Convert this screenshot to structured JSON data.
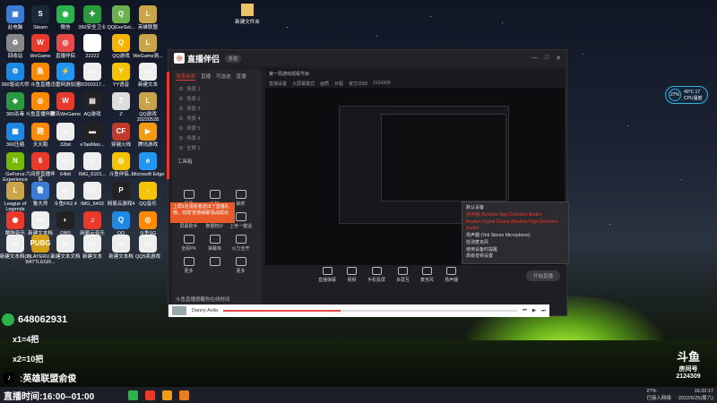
{
  "desktop": {
    "icons": [
      {
        "label": "此电脑",
        "color": "#3a7bd5",
        "glyph": "▣"
      },
      {
        "label": "Steam",
        "color": "#1b2838",
        "glyph": "S"
      },
      {
        "label": "微信",
        "color": "#2bb24c",
        "glyph": "◉"
      },
      {
        "label": "360安全卫士",
        "color": "#2b9a3e",
        "glyph": "✚"
      },
      {
        "label": "QQExeSet...",
        "color": "#6ab04c",
        "glyph": "Q"
      },
      {
        "label": "英雄联盟",
        "color": "#c9a44a",
        "glyph": "L"
      },
      {
        "label": "回收站",
        "color": "#888",
        "glyph": "♻"
      },
      {
        "label": "WeGame",
        "color": "#e8392b",
        "glyph": "W"
      },
      {
        "label": "直播伴侣",
        "color": "#e84a4a",
        "glyph": "◎"
      },
      {
        "label": "22222",
        "color": "#fff",
        "glyph": "▭"
      },
      {
        "label": "QQ游戏",
        "color": "#f4b400",
        "glyph": "Q"
      },
      {
        "label": "WeGame测...",
        "color": "#c9a44a",
        "glyph": "L"
      },
      {
        "label": "360驱动大师",
        "color": "#1e88e5",
        "glyph": "⚙"
      },
      {
        "label": "斗鱼直播",
        "color": "#ff8a00",
        "glyph": "鱼"
      },
      {
        "label": "迅雷网游加速",
        "color": "#2196f3",
        "glyph": "⚡"
      },
      {
        "label": "20200317...",
        "color": "#eee",
        "glyph": "▭"
      },
      {
        "label": "YY语音",
        "color": "#f5c400",
        "glyph": "Y"
      },
      {
        "label": "新建文本",
        "color": "#eee",
        "glyph": "▭"
      },
      {
        "label": "360杀毒",
        "color": "#2b9a3e",
        "glyph": "◈"
      },
      {
        "label": "斗鱼直播伴侣",
        "color": "#ff8a00",
        "glyph": "◎"
      },
      {
        "label": "腾讯WeGame",
        "color": "#e8392b",
        "glyph": "W"
      },
      {
        "label": "AQ游戏",
        "color": "#222",
        "glyph": "▤"
      },
      {
        "label": "Z",
        "color": "#ddd",
        "glyph": "Z"
      },
      {
        "label": "QQ游戏20220528",
        "color": "#c9a44a",
        "glyph": "L"
      },
      {
        "label": "360压缩",
        "color": "#1e88e5",
        "glyph": "▦"
      },
      {
        "label": "天天跑",
        "color": "#ff8a00",
        "glyph": "跑"
      },
      {
        "label": "32bit",
        "color": "#eee",
        "glyph": "▭"
      },
      {
        "label": "eTaaMan...",
        "color": "#222",
        "glyph": "▬"
      },
      {
        "label": "穿越火线",
        "color": "#c0392b",
        "glyph": "CF"
      },
      {
        "label": "腾讯游戏",
        "color": "#f39c12",
        "glyph": "▶"
      },
      {
        "label": "GeForce Experience",
        "color": "#76b900",
        "glyph": "N"
      },
      {
        "label": "六间房直播伴侣",
        "color": "#e8392b",
        "glyph": "6"
      },
      {
        "label": "64bit",
        "color": "#eee",
        "glyph": "▭"
      },
      {
        "label": "IMG_6101...",
        "color": "#eee",
        "glyph": "▭"
      },
      {
        "label": "斗鱼伴侣...",
        "color": "#f5c400",
        "glyph": "◎"
      },
      {
        "label": "Microsoft Edge",
        "color": "#2196f3",
        "glyph": "e"
      },
      {
        "label": "League of Legends",
        "color": "#c9a44a",
        "glyph": "L"
      },
      {
        "label": "鲁大师",
        "color": "#3a7bd5",
        "glyph": "鲁"
      },
      {
        "label": "斗鱼FK2.4",
        "color": "#eee",
        "glyph": "▭"
      },
      {
        "label": "IMG_6403",
        "color": "#eee",
        "glyph": "▭"
      },
      {
        "label": "网易云游戏4",
        "color": "#222",
        "glyph": "P"
      },
      {
        "label": "QQ音乐",
        "color": "#f5c400",
        "glyph": "♪"
      },
      {
        "label": "酷狗音乐",
        "color": "#e8392b",
        "glyph": "◉"
      },
      {
        "label": "新建文本档",
        "color": "#eee",
        "glyph": "▭"
      },
      {
        "label": "OBS",
        "color": "#222",
        "glyph": "◐"
      },
      {
        "label": "网易云音乐",
        "color": "#e8392b",
        "glyph": "♫"
      },
      {
        "label": "QQ",
        "color": "#1e88e5",
        "glyph": "Q"
      },
      {
        "label": "斗鱼SG",
        "color": "#ff8a00",
        "glyph": "◎"
      },
      {
        "label": "新建文本档(2)",
        "color": "#eee",
        "glyph": "▭"
      },
      {
        "label": "PLAYERU... BATTLEGR...",
        "color": "#d4a017",
        "glyph": "PUBG"
      },
      {
        "label": "新建文本文档",
        "color": "#eee",
        "glyph": "▭"
      },
      {
        "label": "新建文本",
        "color": "#eee",
        "glyph": "▭"
      },
      {
        "label": "新建文本档",
        "color": "#eee",
        "glyph": "▭"
      },
      {
        "label": "QQ5卖游戏",
        "color": "#eee",
        "glyph": "▭"
      },
      {
        "label": "迅雷",
        "color": "#1e88e5",
        "glyph": "✈"
      }
    ],
    "folder_top": "新建文件夹"
  },
  "app": {
    "name": "直播伴侣",
    "version_badge": "抖音",
    "tabs": [
      "场景画面",
      "直播",
      "可选选",
      "直播"
    ],
    "scenes": [
      "场景 1",
      "场景 2",
      "场景 3",
      "场景 4",
      "场景 5",
      "场景 6",
      "全屏 1"
    ],
    "tools_label": "工具箱",
    "tools": [
      "投票",
      "礼物",
      "抽奖",
      "屏幕助手",
      "数据统计",
      "上传一键话",
      "全民PK",
      "弹幕库",
      "火力全开",
      "更多",
      "",
      "更多"
    ],
    "toast": "上局1名观看者送出了直播礼物，完成'普通弹幕'挑战成功",
    "preview_title": "第一局游戏观看节目",
    "preview_tabs": [
      "直播设置",
      "大屏幕模式",
      "画质",
      "日程",
      "官方2026",
      "2124309"
    ],
    "bottom_tools": [
      {
        "label": "直播弹幕"
      },
      {
        "label": "视频"
      },
      {
        "label": "手机投屏"
      },
      {
        "label": "多屏互"
      },
      {
        "label": "麦克风"
      },
      {
        "label": "扬声器"
      }
    ],
    "audio_menu": {
      "title": "默认设备",
      "items": [
        {
          "label": "扬声器 (Realtek High Definition Audio)",
          "active": true
        },
        {
          "label": "Realtek Digital Output (Realtek High Definition Audio)",
          "active": true
        },
        {
          "label": "扬声器 (Yeti Stereo Microphone)",
          "active": false
        },
        {
          "label": "检测麦克风",
          "active": false
        },
        {
          "label": "使用设备时提醒",
          "active": false
        },
        {
          "label": "高级音频设置",
          "active": false
        }
      ]
    },
    "go_live": "开始直播",
    "status_text": "斗鱼直播提醒你在线时间",
    "player_user": "Danny Avila",
    "progress": 0.4
  },
  "overlay": {
    "qq_number": "648062931",
    "line1": "x1=4把",
    "line2": "x2=10把",
    "caption": ":英雄联盟俞俊",
    "schedule": "直播时间:16:00--01:00"
  },
  "cpu_widget": {
    "percent": "27%",
    "temp": "40°C 17",
    "label": "CPU温度"
  },
  "douyu": {
    "brand": "斗鱼",
    "room_label": "房间号",
    "room_id": "2124309"
  },
  "taskbar": {
    "apps": [
      "#2bb24c",
      "#e8392b",
      "#f39c12",
      "#e67e22"
    ],
    "battery": "27%",
    "network": "已接入网络",
    "time": "16:32:17",
    "date": "2022/6/25(周六)"
  }
}
